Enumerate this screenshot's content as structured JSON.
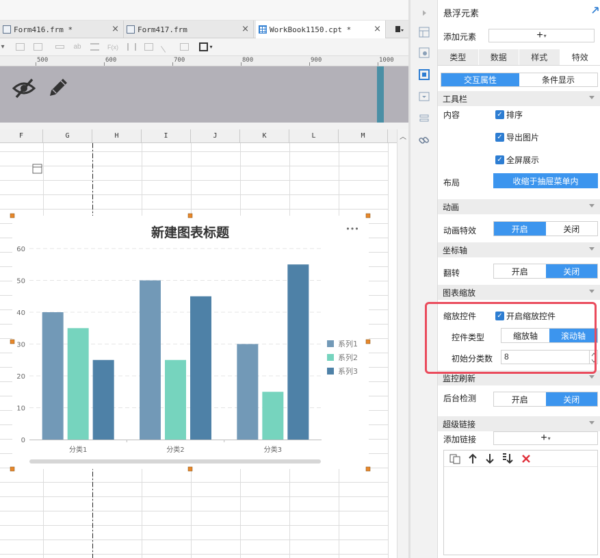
{
  "tabs": [
    {
      "label": "Form416.frm *",
      "close": "×",
      "icon": "form-icon"
    },
    {
      "label": "Form417.frm",
      "close": "×",
      "icon": "form-icon"
    },
    {
      "label": "WorkBook1150.cpt *",
      "close": "×",
      "icon": "workbook-icon"
    }
  ],
  "toolbar": {
    "text_label": "ab",
    "formula_label": "F(x)"
  },
  "ruler": {
    "labels": [
      "500",
      "600",
      "700",
      "800",
      "900",
      "1000"
    ]
  },
  "columns": [
    "F",
    "G",
    "H",
    "I",
    "J",
    "K",
    "L",
    "M"
  ],
  "chart_data": {
    "type": "bar",
    "title": "新建图表标题",
    "categories": [
      "分类1",
      "分类2",
      "分类3"
    ],
    "series": [
      {
        "name": "系列1",
        "values": [
          40,
          50,
          30
        ],
        "color": "#7299b7"
      },
      {
        "name": "系列2",
        "values": [
          35,
          25,
          15
        ],
        "color": "#76d4be"
      },
      {
        "name": "系列3",
        "values": [
          25,
          45,
          55
        ],
        "color": "#4e81a7"
      }
    ],
    "ylim": [
      0,
      60
    ],
    "yticks": [
      "0",
      "10",
      "20",
      "30",
      "40",
      "50",
      "60"
    ],
    "grid": true,
    "legend": "right",
    "more_label": "•••"
  },
  "panel": {
    "title": "悬浮元素",
    "add_element_label": "添加元素",
    "add_symbol": "+",
    "dropdown_symbol": "▾",
    "tabs": [
      "类型",
      "数据",
      "样式",
      "特效"
    ],
    "active_tab": "特效",
    "subtabs": [
      "交互属性",
      "条件显示"
    ],
    "sections": {
      "toolbar": "工具栏",
      "animation": "动画",
      "axis": "坐标轴",
      "zoom": "图表缩放",
      "monitor": "监控刷新",
      "hyperlink": "超级链接"
    },
    "content_label": "内容",
    "checks": {
      "sort": "排序",
      "export": "导出图片",
      "fullscreen": "全屏展示",
      "zoom_widget": "开启缩放控件"
    },
    "layout_label": "布局",
    "layout_value": "收缩于抽屉菜单内",
    "anim_label": "动画特效",
    "flip_label": "翻转",
    "zoom_widget_label": "缩放控件",
    "widget_type_label": "控件类型",
    "widget_type_options": [
      "缩放轴",
      "滚动轴"
    ],
    "init_count_label": "初始分类数",
    "init_count_value": "8",
    "bg_check_label": "后台检测",
    "on_label": "开启",
    "off_label": "关闭",
    "add_link_label": "添加链接"
  },
  "colors": {
    "accent": "#3c95ee",
    "highlight": "#ea4b5c"
  }
}
